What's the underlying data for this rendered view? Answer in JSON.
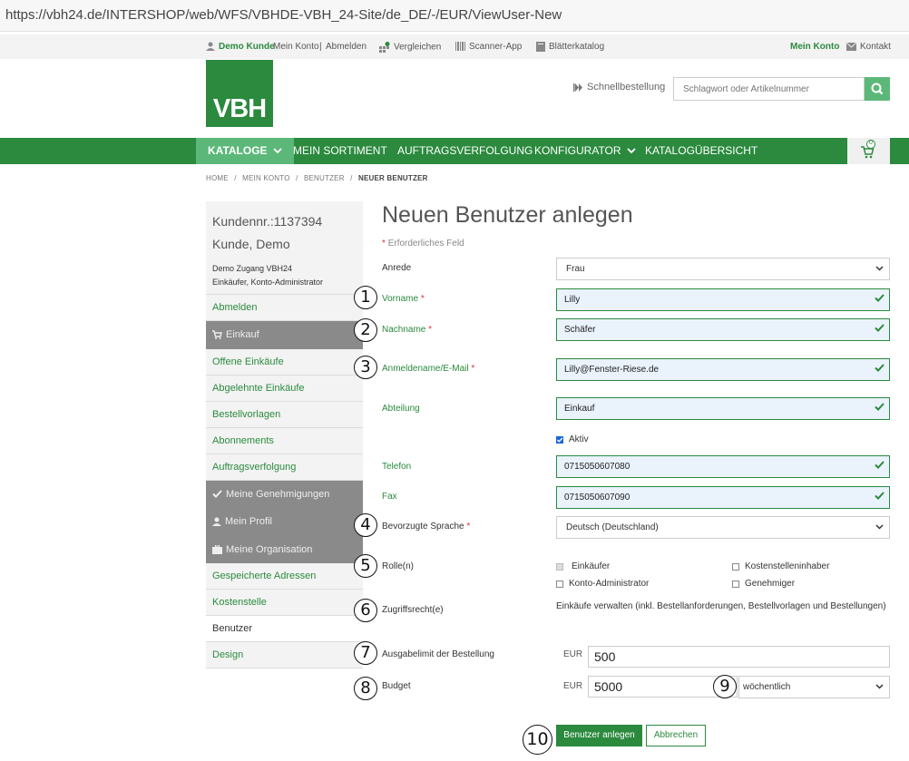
{
  "browser": {
    "url": "https://vbh24.de/INTERSHOP/web/WFS/VBHDE-VBH_24-Site/de_DE/-/EUR/ViewUser-New"
  },
  "topbar": {
    "user": "Demo Kunde",
    "my_account": "Mein Konto",
    "separator": "|",
    "logout": "Abmelden",
    "compare": "Vergleichen",
    "compare_count": "0",
    "scanner": "Scanner-App",
    "catalog": "Blätterkatalog",
    "my_account_right": "Mein Konto",
    "contact": "Kontakt"
  },
  "header": {
    "logo_text": "VBH",
    "quick_order": "Schnellbestellung",
    "search_placeholder": "Schlagwort oder Artikelnummer"
  },
  "nav": {
    "tabs": [
      {
        "label": "KATALOGE"
      },
      {
        "label": "MEIN SORTIMENT"
      },
      {
        "label": "AUFTRAGSVERFOLGUNG"
      },
      {
        "label": "KONFIGURATOR"
      },
      {
        "label": "KATALOGÜBERSICHT"
      }
    ],
    "cart_count": "0"
  },
  "breadcrumb": {
    "home": "HOME",
    "account": "MEIN KONTO",
    "users": "BENUTZER",
    "current": "NEUER BENUTZER",
    "sep": "/"
  },
  "sidebar": {
    "customer_no": "Kundennr.:1137394",
    "customer_name": "Kunde, Demo",
    "access": "Demo Zugang VBH24",
    "roles": "Einkäufer, Konto-Administrator",
    "items": [
      {
        "label": "Abmelden"
      },
      {
        "label": "Einkauf"
      },
      {
        "label": "Offene Einkäufe"
      },
      {
        "label": "Abgelehnte Einkäufe"
      },
      {
        "label": "Bestellvorlagen"
      },
      {
        "label": "Abonnements"
      },
      {
        "label": "Auftragsverfolgung"
      },
      {
        "label": "Meine Genehmigungen"
      },
      {
        "label": "Mein Profil"
      },
      {
        "label": "Meine Organisation"
      },
      {
        "label": "Gespeicherte Adressen"
      },
      {
        "label": "Kostenstelle"
      },
      {
        "label": "Benutzer"
      },
      {
        "label": "Design"
      }
    ]
  },
  "form": {
    "title": "Neuen Benutzer anlegen",
    "required_star": "*",
    "required_note": "Erforderliches Feld",
    "salutation_label": "Anrede",
    "salutation_value": "Frau",
    "firstname_label": "Vorname",
    "firstname_value": "Lilly",
    "lastname_label": "Nachname",
    "lastname_value": "Schäfer",
    "login_label": "Anmeldename/E-Mail",
    "login_value": "Lilly@Fenster-Riese.de",
    "department_label": "Abteilung",
    "department_value": "Einkauf",
    "active_label": "Aktiv",
    "phone_label": "Telefon",
    "phone_value": "0715050607080",
    "fax_label": "Fax",
    "fax_value": "0715050607090",
    "language_label": "Bevorzugte Sprache",
    "language_value": "Deutsch (Deutschland)",
    "roles_label": "Rolle(n)",
    "role_buyer": "Einkäufer",
    "role_cost_center": "Kostenstelleninhaber",
    "role_admin": "Konto-Administrator",
    "role_approver": "Genehmiger",
    "permissions_label": "Zugriffsrecht(e)",
    "permissions_value": "Einkäufe verwalten (inkl. Bestellanforderungen, Bestellvorlagen und Bestellungen)",
    "limit_label": "Ausgabelimit der Bestellung",
    "limit_currency": "EUR",
    "limit_value": "500",
    "budget_label": "Budget",
    "budget_currency": "EUR",
    "budget_value": "5000",
    "budget_period": "wöchentlich",
    "submit": "Benutzer anlegen",
    "cancel": "Abbrechen"
  },
  "annotations": [
    "1",
    "2",
    "3",
    "4",
    "5",
    "6",
    "7",
    "8",
    "9",
    "10"
  ],
  "colors": {
    "brand_green": "#2b8a3e",
    "light_green": "#5cb878",
    "field_bg": "#eaf2fc",
    "sidebar_gray": "#8a8a8a"
  }
}
